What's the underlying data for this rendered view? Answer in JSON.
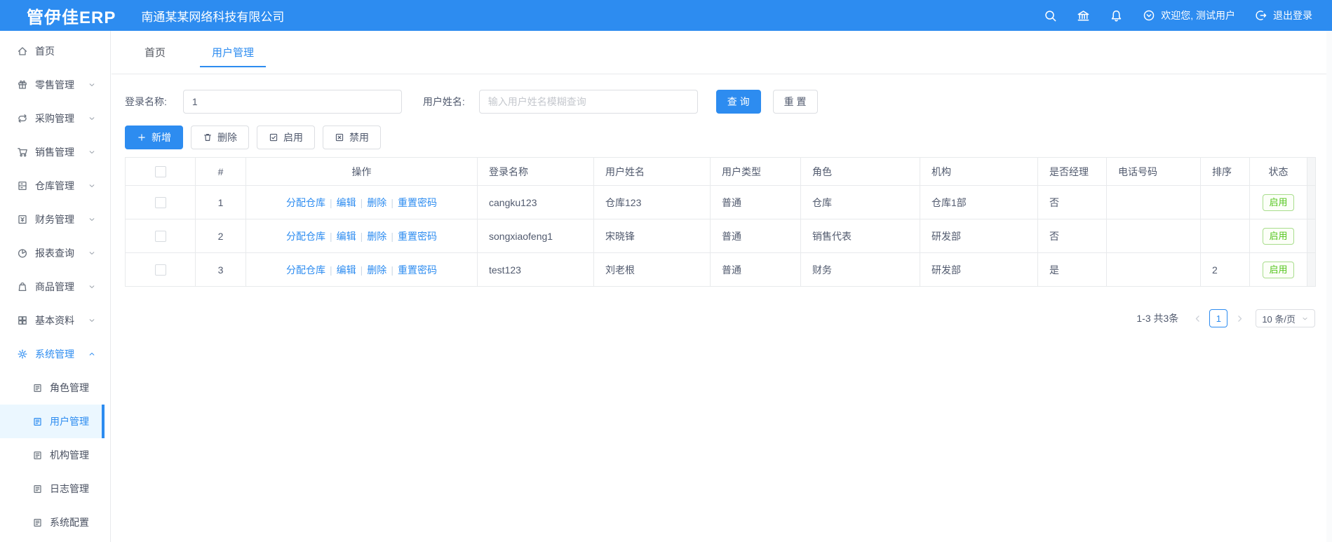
{
  "colors": {
    "primary": "#2d8cf0",
    "success": "#52c41a",
    "header_bg": "#2d8cf0"
  },
  "topbar": {
    "logo": "管伊佳ERP",
    "company": "南通某某网络科技有限公司",
    "welcome": "欢迎您, 测试用户",
    "logout": "退出登录"
  },
  "sidebar": {
    "items": [
      {
        "label": "首页"
      },
      {
        "label": "零售管理"
      },
      {
        "label": "采购管理"
      },
      {
        "label": "销售管理"
      },
      {
        "label": "仓库管理"
      },
      {
        "label": "财务管理"
      },
      {
        "label": "报表查询"
      },
      {
        "label": "商品管理"
      },
      {
        "label": "基本资料"
      },
      {
        "label": "系统管理"
      }
    ],
    "subitems": [
      "角色管理",
      "用户管理",
      "机构管理",
      "日志管理",
      "系统配置"
    ]
  },
  "tabs": [
    {
      "label": "首页"
    },
    {
      "label": "用户管理"
    }
  ],
  "filters": {
    "login_label": "登录名称:",
    "login_value": "1",
    "name_label": "用户姓名:",
    "name_placeholder": "输入用户姓名模糊查询",
    "search": "查 询",
    "reset": "重 置"
  },
  "toolbar": {
    "add": "新增",
    "remove": "删除",
    "enable": "启用",
    "disable": "禁用"
  },
  "table": {
    "columns": [
      "#",
      "操作",
      "登录名称",
      "用户姓名",
      "用户类型",
      "角色",
      "机构",
      "是否经理",
      "电话号码",
      "排序",
      "状态"
    ],
    "actions": [
      "分配仓库",
      "编辑",
      "删除",
      "重置密码"
    ],
    "rows": [
      {
        "num": "1",
        "login": "cangku123",
        "name": "仓库123",
        "type": "普通",
        "role": "仓库",
        "org": "仓库1部",
        "manager": "否",
        "phone": "",
        "sort": "",
        "status": "启用"
      },
      {
        "num": "2",
        "login": "songxiaofeng1",
        "name": "宋晓锋",
        "type": "普通",
        "role": "销售代表",
        "org": "研发部",
        "manager": "否",
        "phone": "",
        "sort": "",
        "status": "启用"
      },
      {
        "num": "3",
        "login": "test123",
        "name": "刘老根",
        "type": "普通",
        "role": "财务",
        "org": "研发部",
        "manager": "是",
        "phone": "",
        "sort": "2",
        "status": "启用"
      }
    ]
  },
  "pagination": {
    "total": "1-3 共3条",
    "page": "1",
    "size": "10 条/页"
  }
}
